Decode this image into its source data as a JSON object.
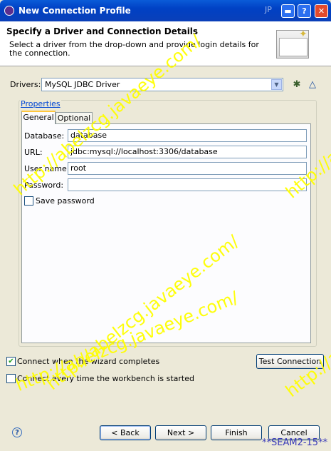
{
  "window": {
    "title": "New Connection Profile",
    "lang_indicator": "JP"
  },
  "banner": {
    "heading": "Specify a Driver and Connection Details",
    "description": "Select a driver from the drop-down and provide login details for the connection."
  },
  "drivers": {
    "label": "Drivers:",
    "selected": "MySQL JDBC Driver"
  },
  "properties": {
    "group_label": "Properties",
    "tabs": [
      {
        "label": "General"
      },
      {
        "label": "Optional"
      }
    ],
    "fields": {
      "database": {
        "label": "Database:",
        "value": "database"
      },
      "url": {
        "label": "URL:",
        "value": "jdbc:mysql://localhost:3306/database"
      },
      "user_name": {
        "label": "User name:",
        "value": "root"
      },
      "password": {
        "label": "Password:",
        "value": ""
      }
    },
    "save_password": {
      "label": "Save password",
      "checked": false
    }
  },
  "options": {
    "connect_when_complete": {
      "label": "Connect when the wizard completes",
      "checked": true
    },
    "connect_every_time": {
      "label": "Connect every time the workbench is started",
      "checked": false
    }
  },
  "buttons": {
    "test_connection": "Test Connection",
    "back": "< Back",
    "next": "Next >",
    "finish": "Finish",
    "cancel": "Cancel"
  },
  "watermark": {
    "text": "http://abelzcg.javaeye.com/"
  },
  "footer_tag": "**SEAM2-15**"
}
